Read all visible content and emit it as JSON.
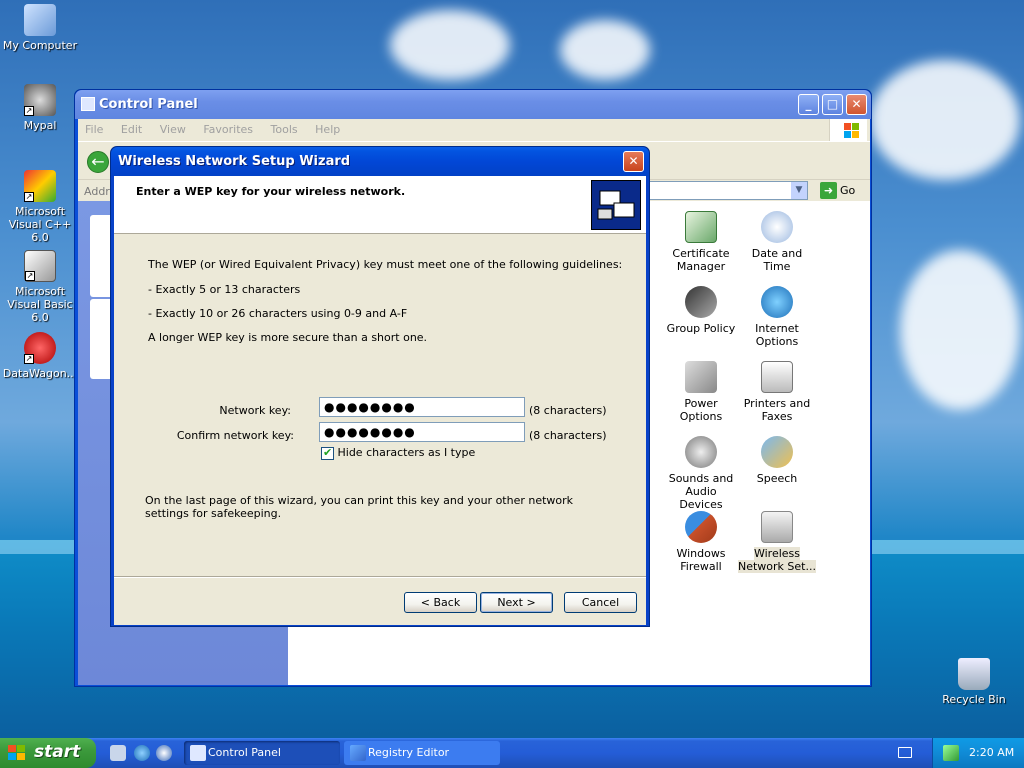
{
  "desktop": {
    "icons": [
      {
        "label": "My Computer"
      },
      {
        "label": "Mypal"
      },
      {
        "label": "Microsoft Visual C++ 6.0"
      },
      {
        "label": "Microsoft Visual Basic 6.0"
      },
      {
        "label": "DataWagon..."
      },
      {
        "label": "Recycle Bin"
      }
    ]
  },
  "control_panel": {
    "title": "Control Panel",
    "menu": [
      "File",
      "Edit",
      "View",
      "Favorites",
      "Tools",
      "Help"
    ],
    "address_label": "Address",
    "go_label": "Go",
    "items": [
      {
        "label": "Certificate Manager"
      },
      {
        "label": "Date and Time"
      },
      {
        "label": "Group Policy"
      },
      {
        "label": "Internet Options"
      },
      {
        "label": "Power Options"
      },
      {
        "label": "Printers and Faxes"
      },
      {
        "label": "Sounds and Audio Devices"
      },
      {
        "label": "Speech"
      },
      {
        "label": "Windows Firewall"
      },
      {
        "label": "Wireless Network Set..."
      }
    ]
  },
  "wizard": {
    "title": "Wireless Network Setup Wizard",
    "header": "Enter a WEP key for your wireless network.",
    "guideline_intro": "The WEP (or Wired Equivalent Privacy) key must meet one of the following guidelines:",
    "guideline_1": "- Exactly 5 or 13 characters",
    "guideline_2": "- Exactly 10 or 26 characters using 0-9 and A-F",
    "guideline_3": "A longer WEP key is more secure than a short one.",
    "network_key_label": "Network key:",
    "network_key_value": "●●●●●●●●",
    "network_key_note": "(8 characters)",
    "confirm_key_label": "Confirm network key:",
    "confirm_key_value": "●●●●●●●●",
    "confirm_key_note": "(8 characters)",
    "hide_chars_label": "Hide characters as I type",
    "footer_text": "On the last page of this wizard, you can print this key and your other network settings for safekeeping.",
    "back_label": "< Back",
    "next_label": "Next >",
    "cancel_label": "Cancel"
  },
  "taskbar": {
    "start_label": "start",
    "tasks": [
      {
        "label": "Control Panel"
      },
      {
        "label": "Registry Editor"
      }
    ],
    "clock": "2:20 AM"
  }
}
